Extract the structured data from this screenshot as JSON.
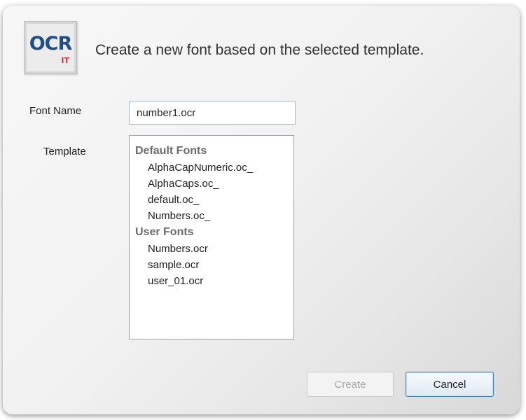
{
  "dialog": {
    "logo": {
      "main": "OCR",
      "sub": "IT"
    },
    "headline": "Create a new font based on the selected template."
  },
  "form": {
    "font_name_label": "Font Name",
    "font_name_value": "number1.ocr",
    "template_label": "Template"
  },
  "template_list": {
    "default_header": "Default Fonts",
    "default_items": [
      "AlphaCapNumeric.oc_",
      "AlphaCaps.oc_",
      "default.oc_",
      "Numbers.oc_"
    ],
    "user_header": "User Fonts",
    "user_items": [
      "Numbers.ocr",
      "sample.ocr",
      "user_01.ocr"
    ]
  },
  "buttons": {
    "create_label": "Create",
    "create_enabled": false,
    "cancel_label": "Cancel"
  }
}
